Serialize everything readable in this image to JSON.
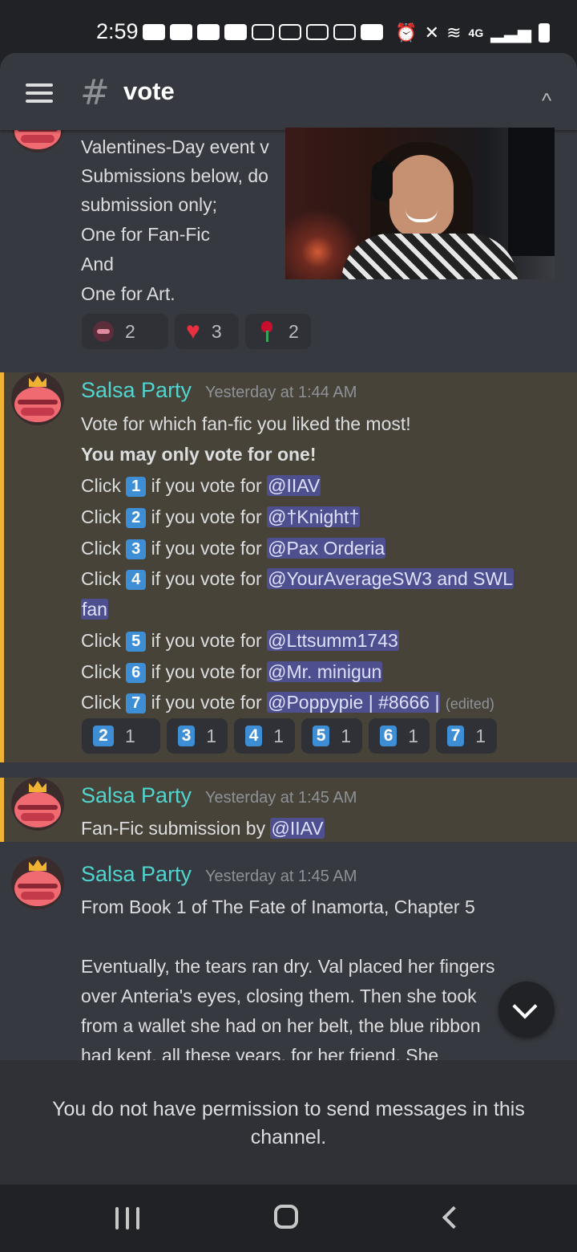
{
  "status_bar": {
    "time": "2:59",
    "network": "4G"
  },
  "header": {
    "channel_name": "vote"
  },
  "partial_message": {
    "lines": [
      "Valentines-Day event v",
      "Submissions below, do",
      "submission only;",
      "One for Fan-Fic",
      "And",
      "One for Art."
    ],
    "reactions": [
      {
        "icon": "mask-emoji-icon",
        "count": "2"
      },
      {
        "icon": "heart-emoji-icon",
        "count": "3"
      },
      {
        "icon": "rose-emoji-icon",
        "count": "2"
      }
    ]
  },
  "message_1": {
    "author": "Salsa Party",
    "timestamp": "Yesterday at 1:44 AM",
    "intro": "Vote for which fan-fic you liked the most!",
    "bold_line": "You may only vote for one!",
    "click_word": "Click",
    "vote_phrase": "if you vote for",
    "options": [
      {
        "key": "1",
        "mention": "@IIAV"
      },
      {
        "key": "2",
        "mention": "@†Knight†"
      },
      {
        "key": "3",
        "mention": "@Pax Orderia"
      },
      {
        "key": "4",
        "mention": "@YourAverageSW3 and SWL",
        "mention_cont": "fan"
      },
      {
        "key": "5",
        "mention": "@Lttsumm1743"
      },
      {
        "key": "6",
        "mention": "@Mr. minigun"
      },
      {
        "key": "7",
        "mention": "@Poppypie | #8666 |"
      }
    ],
    "edited": "(edited)",
    "reactions": [
      {
        "key": "2",
        "count": "1"
      },
      {
        "key": "3",
        "count": "1"
      },
      {
        "key": "4",
        "count": "1"
      },
      {
        "key": "5",
        "count": "1"
      },
      {
        "key": "6",
        "count": "1"
      },
      {
        "key": "7",
        "count": "1"
      }
    ]
  },
  "message_2": {
    "author": "Salsa Party",
    "timestamp": "Yesterday at 1:45 AM",
    "text": "Fan-Fic submission by",
    "mention": "@IIAV"
  },
  "message_3": {
    "author": "Salsa Party",
    "timestamp": "Yesterday at 1:45 AM",
    "lines": [
      "From Book 1 of The Fate of Inamorta, Chapter 5",
      "Eventually, the tears ran dry. Val placed her fingers",
      "over Anteria's eyes, closing them. Then she took",
      "from a wallet she had on her belt, the blue ribbon",
      "had kept, all these years, for her friend. She"
    ]
  },
  "footer": {
    "no_permission": "You do not have permission to send messages in this channel."
  },
  "colors": {
    "accent": "#f0b232",
    "username": "#4fd6d0",
    "mention_bg": "#4e4f8f",
    "keycap": "#3e8ed6"
  }
}
